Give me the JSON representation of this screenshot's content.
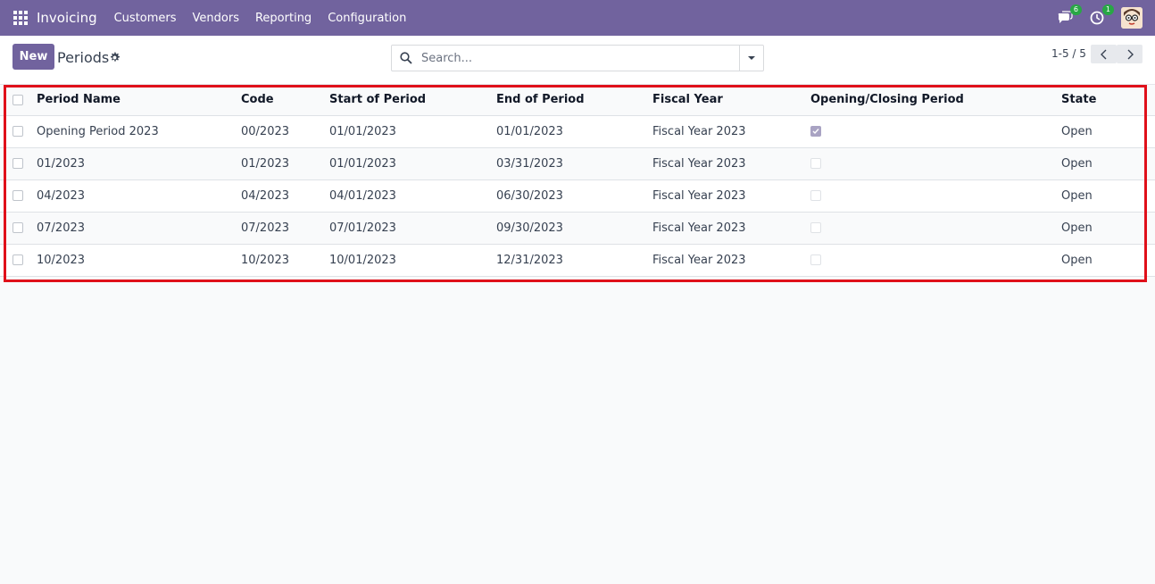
{
  "navbar": {
    "brand": "Invoicing",
    "menu": [
      "Customers",
      "Vendors",
      "Reporting",
      "Configuration"
    ],
    "messages_count": "6",
    "activities_count": "1"
  },
  "control_panel": {
    "new_label": "New",
    "title": "Periods",
    "search_placeholder": "Search...",
    "pager": "1-5 / 5"
  },
  "table": {
    "columns": [
      "Period Name",
      "Code",
      "Start of Period",
      "End of Period",
      "Fiscal Year",
      "Opening/Closing Period",
      "State"
    ],
    "rows": [
      {
        "name": "Opening Period 2023",
        "code": "00/2023",
        "start": "01/01/2023",
        "end": "01/01/2023",
        "fiscal_year": "Fiscal Year 2023",
        "opening_closing": true,
        "state": "Open"
      },
      {
        "name": "01/2023",
        "code": "01/2023",
        "start": "01/01/2023",
        "end": "03/31/2023",
        "fiscal_year": "Fiscal Year 2023",
        "opening_closing": false,
        "state": "Open"
      },
      {
        "name": "04/2023",
        "code": "04/2023",
        "start": "04/01/2023",
        "end": "06/30/2023",
        "fiscal_year": "Fiscal Year 2023",
        "opening_closing": false,
        "state": "Open"
      },
      {
        "name": "07/2023",
        "code": "07/2023",
        "start": "07/01/2023",
        "end": "09/30/2023",
        "fiscal_year": "Fiscal Year 2023",
        "opening_closing": false,
        "state": "Open"
      },
      {
        "name": "10/2023",
        "code": "10/2023",
        "start": "10/01/2023",
        "end": "12/31/2023",
        "fiscal_year": "Fiscal Year 2023",
        "opening_closing": false,
        "state": "Open"
      }
    ]
  },
  "colors": {
    "brand": "#71639e",
    "highlight": "#e0101a",
    "badge": "#28a745"
  }
}
